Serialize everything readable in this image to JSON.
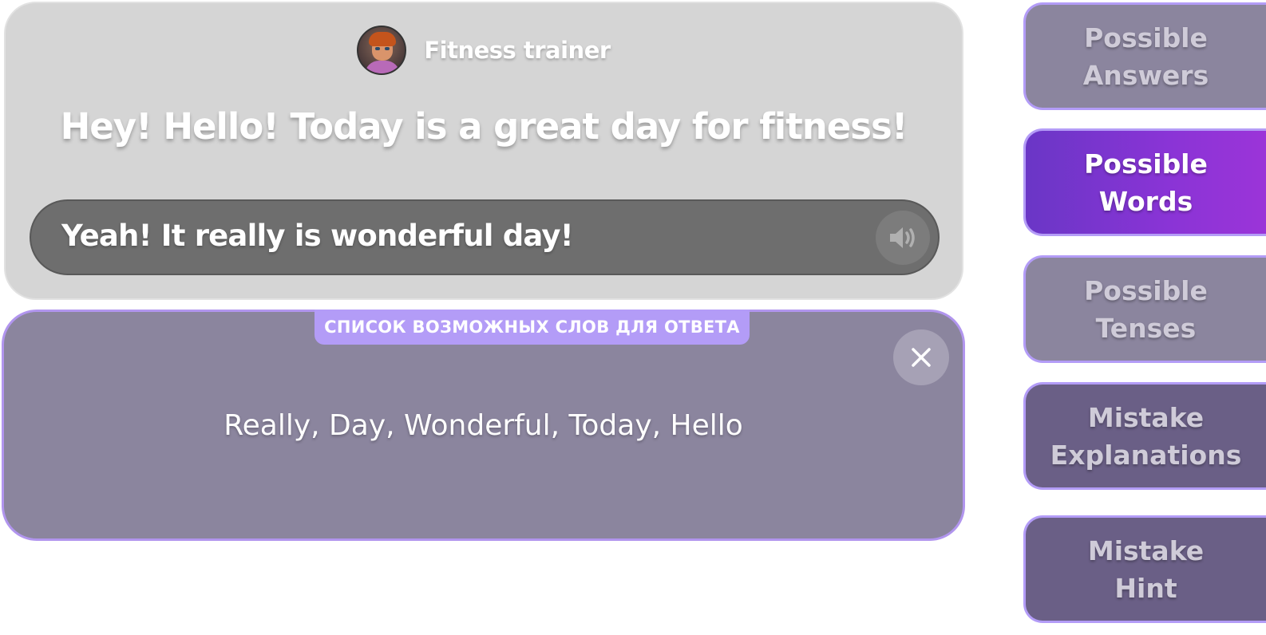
{
  "dialog": {
    "speaker_name": "Fitness trainer",
    "question": "Hey! Hello! Today is a great day for fitness!",
    "answer": "Yeah! It really is wonderful day!",
    "audio_icon": "speaker-icon"
  },
  "hint_panel": {
    "tab_label": "СПИСОК ВОЗМОЖНЫХ СЛОВ ДЛЯ ОТВЕТА",
    "words": "Really, Day, Wonderful, Today, Hello",
    "close_icon": "close-icon"
  },
  "side_menu": {
    "possible_answers": [
      "Possible",
      "Answers"
    ],
    "possible_words": [
      "Possible",
      "Words"
    ],
    "possible_tenses": [
      "Possible",
      "Tenses"
    ],
    "mistake_explanations": [
      "Mistake",
      "Explanations"
    ],
    "mistake_hint": [
      "Mistake",
      "Hint"
    ],
    "active_item": "possible_words"
  },
  "colors": {
    "card_bg": "#d5d5d5",
    "answer_bar_bg": "#6e6e6e",
    "hint_panel_bg": "#8b859e",
    "accent_border": "#b39cf7",
    "active_button": "#7a35d0"
  }
}
